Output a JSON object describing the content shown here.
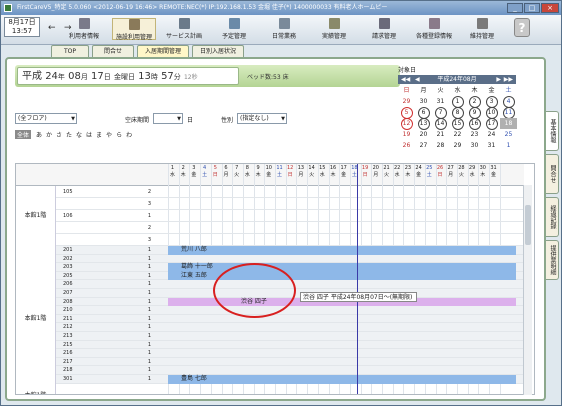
{
  "window": {
    "title": "FirstCareV5_特定 5.0.060 <2012-06-19 16:46> REMOTE:NEC(*) IP:192.168.1.53 金堀 佳子(*) 1400000033 有料老人ホームピー"
  },
  "toolbar": {
    "date": "8月17日",
    "time": "13:57",
    "items": [
      {
        "label": "利用者情報",
        "icon": "user-icon",
        "color": "#7a7a8a"
      },
      {
        "label": "施設利用管理",
        "icon": "facility-icon",
        "color": "#8a7a5a"
      },
      {
        "label": "サービス計画",
        "icon": "service-plan-icon",
        "color": "#6a7a8a"
      },
      {
        "label": "予定管理",
        "icon": "schedule-icon",
        "color": "#6a8aa8"
      },
      {
        "label": "日常業務",
        "icon": "daily-work-icon",
        "color": "#7a8a9a"
      },
      {
        "label": "実績管理",
        "icon": "results-icon",
        "color": "#8a8a6a"
      },
      {
        "label": "請求管理",
        "icon": "billing-icon",
        "color": "#6a6a7a"
      },
      {
        "label": "各種登録情報",
        "icon": "registry-icon",
        "color": "#8a7a8a"
      },
      {
        "label": "維持管理",
        "icon": "maintenance-icon",
        "color": "#7a7a7a"
      }
    ],
    "help": "?"
  },
  "tabs": [
    "TOP",
    "問合せ",
    "入居期間管理",
    "日別入居状況"
  ],
  "banner": {
    "era": "平成",
    "year": "24",
    "month": "08",
    "day": "17",
    "weekday": "金曜日",
    "hour": "13",
    "minute": "57",
    "second": "12秒",
    "bed_count": "ベッド数:53 床"
  },
  "calendar": {
    "label": "対象日",
    "header": "平成24年08月",
    "days": [
      "日",
      "月",
      "火",
      "水",
      "木",
      "金",
      "土"
    ],
    "cells": [
      "29",
      "30",
      "31",
      "1",
      "2",
      "3",
      "4",
      "5",
      "6",
      "7",
      "8",
      "9",
      "10",
      "11",
      "12",
      "13",
      "14",
      "15",
      "16",
      "17",
      "18",
      "19",
      "20",
      "21",
      "22",
      "23",
      "24",
      "25",
      "26",
      "27",
      "28",
      "29",
      "30",
      "31",
      "1"
    ]
  },
  "filters": {
    "floor": "(全フロア)",
    "vacancy_label": "空床期間",
    "days_label": "日",
    "gender_label": "性別",
    "gender": "(指定なし)"
  },
  "kana": {
    "all": "全体",
    "letters": [
      "あ",
      "か",
      "さ",
      "た",
      "な",
      "は",
      "ま",
      "や",
      "ら",
      "わ"
    ]
  },
  "grid": {
    "day_numbers": [
      "1",
      "2",
      "3",
      "4",
      "5",
      "6",
      "7",
      "8",
      "9",
      "10",
      "11",
      "12",
      "13",
      "14",
      "15",
      "16",
      "17",
      "18",
      "19",
      "20",
      "21",
      "22",
      "23",
      "24",
      "25",
      "26",
      "27",
      "28",
      "29",
      "30",
      "31"
    ],
    "weekdays": [
      "水",
      "木",
      "金",
      "土",
      "日",
      "月",
      "火",
      "水",
      "木",
      "金",
      "土",
      "日",
      "月",
      "火",
      "水",
      "木",
      "金",
      "土",
      "日",
      "月",
      "火",
      "水",
      "木",
      "金",
      "土",
      "日",
      "月",
      "火",
      "水",
      "木",
      "金"
    ],
    "floors": [
      "本館1階",
      "本館1階",
      "本館1階"
    ],
    "rows": [
      {
        "room": "105",
        "count": "2",
        "occupant": ""
      },
      {
        "room": "",
        "count": "3",
        "occupant": ""
      },
      {
        "room": "106",
        "count": "1",
        "occupant": ""
      },
      {
        "room": "",
        "count": "2",
        "occupant": ""
      },
      {
        "room": "",
        "count": "3",
        "occupant": ""
      },
      {
        "room": "201",
        "count": "1",
        "occupant": "荒川 八郎"
      },
      {
        "room": "202",
        "count": "1",
        "occupant": ""
      },
      {
        "room": "203",
        "count": "1",
        "occupant": "葛飾 十一郎"
      },
      {
        "room": "205",
        "count": "1",
        "occupant": "江東 五郎"
      },
      {
        "room": "206",
        "count": "1",
        "occupant": ""
      },
      {
        "room": "207",
        "count": "1",
        "occupant": ""
      },
      {
        "room": "208",
        "count": "1",
        "occupant": "渋谷 四子"
      },
      {
        "room": "210",
        "count": "1",
        "occupant": ""
      },
      {
        "room": "211",
        "count": "1",
        "occupant": ""
      },
      {
        "room": "212",
        "count": "1",
        "occupant": ""
      },
      {
        "room": "213",
        "count": "1",
        "occupant": ""
      },
      {
        "room": "215",
        "count": "1",
        "occupant": ""
      },
      {
        "room": "216",
        "count": "1",
        "occupant": ""
      },
      {
        "room": "217",
        "count": "1",
        "occupant": ""
      },
      {
        "room": "218",
        "count": "1",
        "occupant": ""
      },
      {
        "room": "301",
        "count": "1",
        "occupant": "豊島 七郎"
      }
    ],
    "tooltip": "渋谷 四子 平成24年08月07日～(無期限)"
  },
  "side_tabs": [
    "基本情報",
    "問合せ",
    "経過記録",
    "提供票明細"
  ]
}
